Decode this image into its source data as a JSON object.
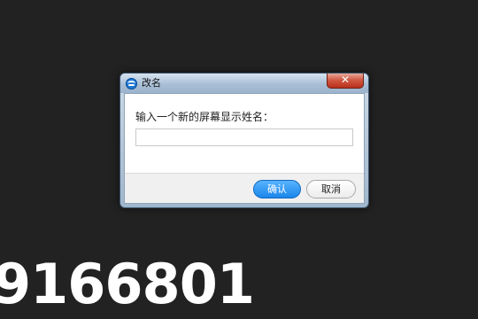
{
  "dialog": {
    "title": "改名",
    "prompt": "输入一个新的屏幕显示姓名：",
    "input_value": "",
    "close_symbol": "✕",
    "ok_label": "确认",
    "cancel_label": "取消",
    "icon": "app-logo-icon"
  },
  "overlay": {
    "number": "9166801"
  },
  "colors": {
    "background": "#222222",
    "ok_button": "#1a86ea",
    "close_button": "#c8402a"
  }
}
